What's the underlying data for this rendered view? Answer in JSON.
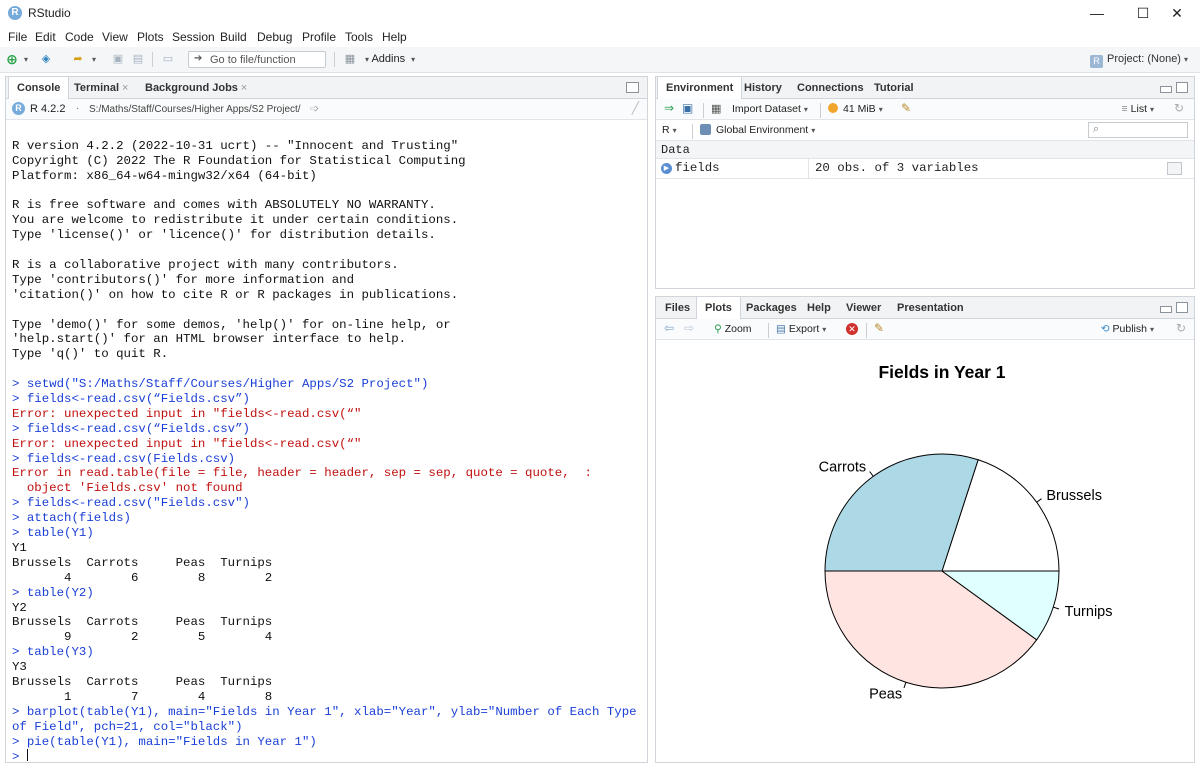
{
  "window": {
    "title": "RStudio",
    "minimize": "—",
    "maximize": "☐",
    "close": "✕"
  },
  "menu": [
    "File",
    "Edit",
    "Code",
    "View",
    "Plots",
    "Session",
    "Build",
    "Debug",
    "Profile",
    "Tools",
    "Help"
  ],
  "toolbar": {
    "goto_placeholder": "Go to file/function",
    "addins_label": "Addins",
    "project_label": "Project: (None)"
  },
  "console_pane": {
    "tabs": [
      {
        "label": "Console",
        "closable": false
      },
      {
        "label": "Terminal",
        "closable": true
      },
      {
        "label": "Background Jobs",
        "closable": true
      }
    ],
    "r_version_label": "R 4.2.2",
    "path": "S:/Maths/Staff/Courses/Higher Apps/S2 Project/",
    "lines": [
      {
        "type": "out",
        "text": ""
      },
      {
        "type": "out",
        "text": "R version 4.2.2 (2022-10-31 ucrt) -- \"Innocent and Trusting\""
      },
      {
        "type": "out",
        "text": "Copyright (C) 2022 The R Foundation for Statistical Computing"
      },
      {
        "type": "out",
        "text": "Platform: x86_64-w64-mingw32/x64 (64-bit)"
      },
      {
        "type": "out",
        "text": ""
      },
      {
        "type": "out",
        "text": "R is free software and comes with ABSOLUTELY NO WARRANTY."
      },
      {
        "type": "out",
        "text": "You are welcome to redistribute it under certain conditions."
      },
      {
        "type": "out",
        "text": "Type 'license()' or 'licence()' for distribution details."
      },
      {
        "type": "out",
        "text": ""
      },
      {
        "type": "out",
        "text": "R is a collaborative project with many contributors."
      },
      {
        "type": "out",
        "text": "Type 'contributors()' for more information and"
      },
      {
        "type": "out",
        "text": "'citation()' on how to cite R or R packages in publications."
      },
      {
        "type": "out",
        "text": ""
      },
      {
        "type": "out",
        "text": "Type 'demo()' for some demos, 'help()' for on-line help, or"
      },
      {
        "type": "out",
        "text": "'help.start()' for an HTML browser interface to help."
      },
      {
        "type": "out",
        "text": "Type 'q()' to quit R."
      },
      {
        "type": "out",
        "text": ""
      },
      {
        "type": "cmd",
        "text": "> setwd(\"S:/Maths/Staff/Courses/Higher Apps/S2 Project\")"
      },
      {
        "type": "cmd",
        "text": "> fields<-read.csv(“Fields.csv”)"
      },
      {
        "type": "err",
        "text": "Error: unexpected input in \"fields<-read.csv(“\""
      },
      {
        "type": "cmd",
        "text": "> fields<-read.csv(“Fields.csv”)"
      },
      {
        "type": "err",
        "text": "Error: unexpected input in \"fields<-read.csv(“\""
      },
      {
        "type": "cmd",
        "text": "> fields<-read.csv(Fields.csv)"
      },
      {
        "type": "err",
        "text": "Error in read.table(file = file, header = header, sep = sep, quote = quote,  :"
      },
      {
        "type": "err",
        "text": "  object 'Fields.csv' not found"
      },
      {
        "type": "cmd",
        "text": "> fields<-read.csv(\"Fields.csv\")"
      },
      {
        "type": "cmd",
        "text": "> attach(fields)"
      },
      {
        "type": "cmd",
        "text": "> table(Y1)"
      },
      {
        "type": "out",
        "text": "Y1"
      },
      {
        "type": "out",
        "text": "Brussels  Carrots     Peas  Turnips"
      },
      {
        "type": "out",
        "text": "       4        6        8        2"
      },
      {
        "type": "cmd",
        "text": "> table(Y2)"
      },
      {
        "type": "out",
        "text": "Y2"
      },
      {
        "type": "out",
        "text": "Brussels  Carrots     Peas  Turnips"
      },
      {
        "type": "out",
        "text": "       9        2        5        4"
      },
      {
        "type": "cmd",
        "text": "> table(Y3)"
      },
      {
        "type": "out",
        "text": "Y3"
      },
      {
        "type": "out",
        "text": "Brussels  Carrots     Peas  Turnips"
      },
      {
        "type": "out",
        "text": "       1        7        4        8"
      },
      {
        "type": "cmd",
        "text": "> barplot(table(Y1), main=\"Fields in Year 1\", xlab=\"Year\", ylab=\"Number of Each Type"
      },
      {
        "type": "cmd",
        "text": "of Field\", pch=21, col=\"black\")"
      },
      {
        "type": "cmd",
        "text": "> pie(table(Y1), main=\"Fields in Year 1\")"
      },
      {
        "type": "cmd",
        "text": "> "
      }
    ]
  },
  "env_pane": {
    "tabs": [
      "Environment",
      "History",
      "Connections",
      "Tutorial"
    ],
    "import_label": "Import Dataset",
    "memory_label": "41 MiB",
    "list_label": "List",
    "lang_label": "R",
    "scope_label": "Global Environment",
    "section_label": "Data",
    "rows": [
      {
        "name": "fields",
        "value": "20 obs. of 3 variables"
      }
    ]
  },
  "plots_pane": {
    "tabs": [
      "Files",
      "Plots",
      "Packages",
      "Help",
      "Viewer",
      "Presentation"
    ],
    "zoom_label": "Zoom",
    "export_label": "Export",
    "publish_label": "Publish"
  },
  "chart_data": {
    "type": "pie",
    "title": "Fields in Year 1",
    "categories": [
      "Brussels",
      "Carrots",
      "Peas",
      "Turnips"
    ],
    "values": [
      4,
      6,
      8,
      2
    ],
    "colors": [
      "#ffffff",
      "#add8e6",
      "#ffe4e1",
      "#e0ffff"
    ],
    "start_angle_deg": 0,
    "direction": "counterclockwise"
  }
}
